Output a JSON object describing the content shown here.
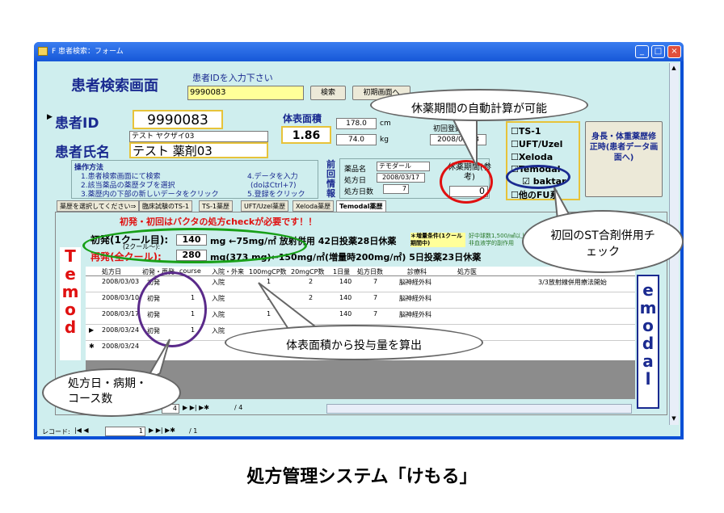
{
  "window": {
    "title": "F 患者検索：フォーム",
    "min": "_",
    "max": "□",
    "close": "×"
  },
  "header": {
    "screen_title": "患者検索画面",
    "prompt": "患者IDを入力下さい",
    "search_value": "9990083",
    "search_button": "検索",
    "reset_button": "初期画面へ"
  },
  "patient": {
    "id_label": "患者ID",
    "id_value": "9990083",
    "name_label": "患者氏名",
    "kana": "テスト ヤクザイ03",
    "name": "テスト 薬剤03",
    "bsa_label": "体表面積",
    "bsa_value": "1.86",
    "height": "178.0",
    "height_unit": "cm",
    "weight": "74.0",
    "weight_unit": "kg",
    "first_reg_label": "初回登録日",
    "first_reg_date": "2008/03/03"
  },
  "ops": {
    "title": "操作方法",
    "items": [
      "1.患者検索画面にて検索",
      "2.該当薬品の薬歴タブを選択",
      "3.薬歴内の下部の新しいデータをクリック",
      "4.データを入力",
      "(doはCtrl+7)",
      "5.登録をクリック"
    ]
  },
  "prev_info": {
    "label": "前回情報",
    "drug_label": "薬品名",
    "drug": "テモダール",
    "date_label": "処方日",
    "date": "2008/03/17",
    "days_label": "処方日数",
    "days": "7",
    "rest_label": "休薬期間(参考)",
    "rest": "0"
  },
  "checks": {
    "items": [
      {
        "label": "TS-1",
        "checked": false
      },
      {
        "label": "UFT/Uzel",
        "checked": false
      },
      {
        "label": "Xeloda",
        "checked": false
      },
      {
        "label": "Temodal",
        "checked": true
      },
      {
        "label": "baktar",
        "checked": true
      },
      {
        "label": "他のFU系",
        "checked": false
      }
    ],
    "modify_button": "身長・体重薬歴修正時(患者データ画面へ)"
  },
  "tabs": [
    "薬歴を選択してください⇒",
    "臨床試験のTS-1",
    "TS-1薬歴",
    "UFT/Uzel薬歴",
    "Xeloda薬歴",
    "Temodal薬歴"
  ],
  "warning": "初発・初回はバクタの処方checkが必要です！！",
  "dose": {
    "first_label": "初発(1クール目):",
    "first_sub": "(2クール～):",
    "first_value": "140",
    "first_rule": "mg ←75mg/㎡ 放射併用 42日投薬28日休薬",
    "recur_label": "再発(全クール):",
    "recur_value": "280",
    "recur_rule": "mg(373 mg)←150mg/㎡(増量時200mg/㎡) 5日投薬23日休薬",
    "incr_label": "＊増量条件(1クール期間中)",
    "incr_text": "好中球数1,500/㎣以上 非血液学的副作用"
  },
  "table": {
    "headers": [
      "処方日",
      "初発・再発",
      "course",
      "入院・外来",
      "100mgCP数",
      "20mgCP数",
      "1日量",
      "処方日数",
      "診療科",
      "処方医"
    ],
    "rows": [
      [
        "2008/03/03",
        "初発",
        "",
        "入院",
        "1",
        "2",
        "140",
        "7",
        "脳神経外科",
        ""
      ],
      [
        "2008/03/10",
        "初発",
        "1",
        "入院",
        "1",
        "2",
        "140",
        "7",
        "脳神経外科",
        ""
      ],
      [
        "2008/03/17",
        "初発",
        "1",
        "入院",
        "1",
        "",
        "140",
        "7",
        "脳神経外科",
        ""
      ],
      [
        "2008/03/24",
        "初発",
        "1",
        "入院",
        "",
        "",
        "",
        "",
        "",
        ""
      ],
      [
        "2008/03/24",
        "",
        "",
        "",
        "",
        "",
        "",
        "",
        "",
        ""
      ]
    ],
    "note": "3/3放射線併用療法開始",
    "subrecord": "4",
    "subrecord_total": "/ 4"
  },
  "footer": {
    "record_label": "レコード:",
    "record": "1",
    "total": "/ 1"
  },
  "side_text_left": [
    "T",
    "e",
    "m",
    "o",
    "d"
  ],
  "side_text_right": [
    "e",
    "m",
    "o",
    "d",
    "a",
    "l"
  ],
  "callouts": {
    "auto_rest": "休薬期間の自動計算が可能",
    "st_check": "初回のST合剤併用チェック",
    "bsa_calc": "体表面積から投与量を算出",
    "course_info": "処方日・病期・コース数"
  },
  "caption": "処方管理システム「けもる」",
  "colors": {
    "title_blue": "#1657d8",
    "form_bg": "#cfeeee",
    "accent_red": "#e01010",
    "ring_green": "#18a018",
    "ring_purple": "#5a2a8a",
    "ring_navy": "#1a2a90"
  }
}
